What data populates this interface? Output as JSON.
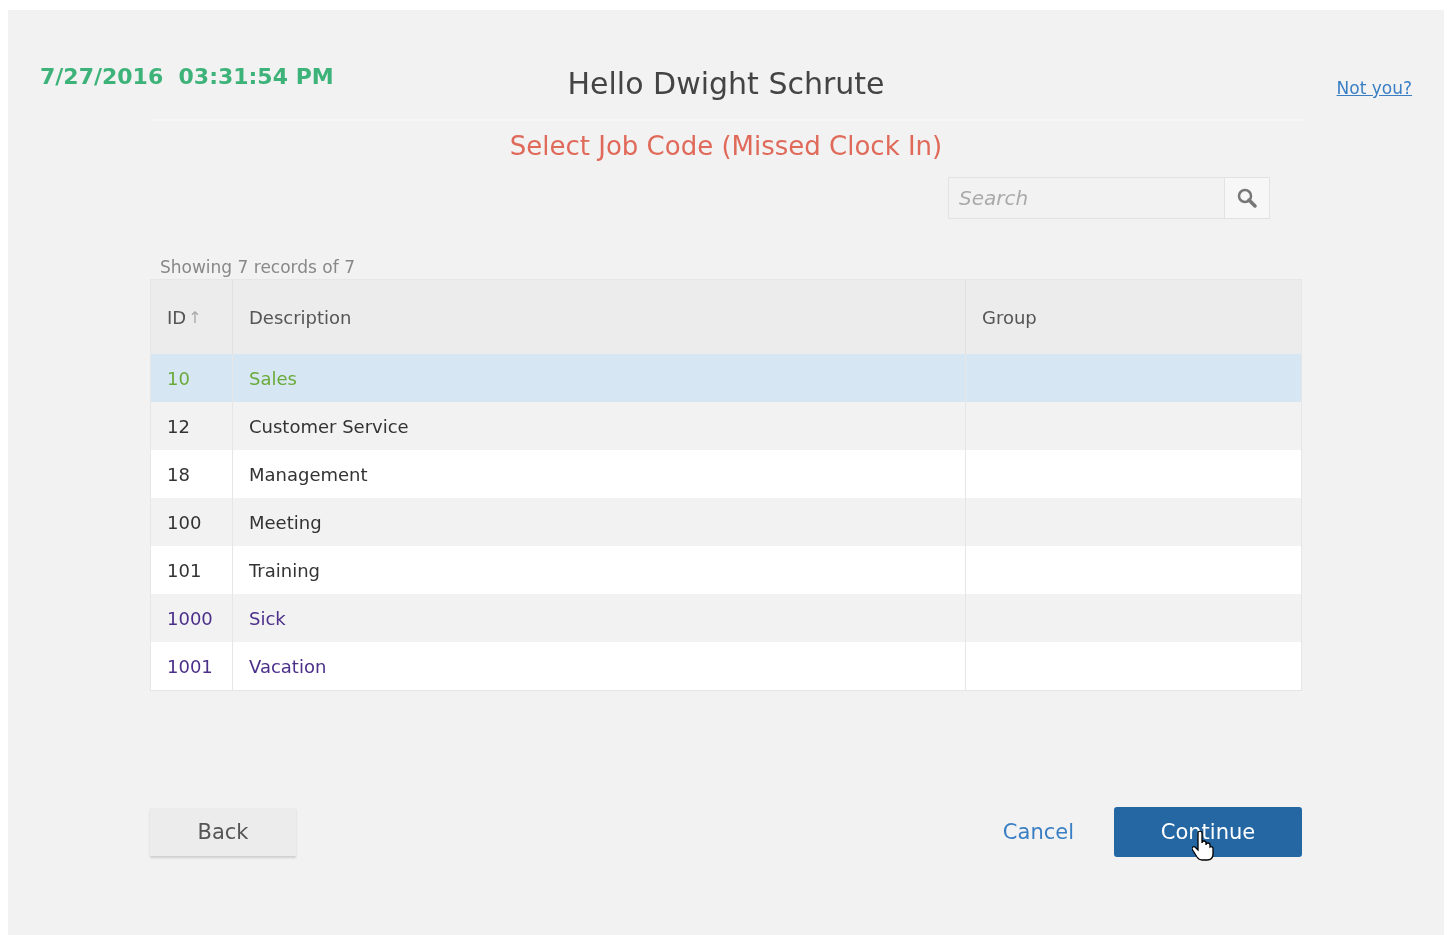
{
  "header": {
    "datetime": "7/27/2016  03:31:54 PM",
    "greeting": "Hello Dwight Schrute",
    "not_you": "Not you?"
  },
  "subtitle": "Select Job Code (Missed Clock In)",
  "search": {
    "placeholder": "Search"
  },
  "table": {
    "summary": "Showing 7 records of 7",
    "columns": [
      {
        "label": "ID",
        "sort": "↑"
      },
      {
        "label": "Description"
      },
      {
        "label": "Group"
      }
    ],
    "rows": [
      {
        "id": "10",
        "description": "Sales",
        "selected": true,
        "color": "#6aaa3a"
      },
      {
        "id": "12",
        "description": "Customer Service",
        "selected": false,
        "color": "#333333"
      },
      {
        "id": "18",
        "description": "Management",
        "selected": false,
        "color": "#333333"
      },
      {
        "id": "100",
        "description": "Meeting",
        "selected": false,
        "color": "#333333"
      },
      {
        "id": "101",
        "description": "Training",
        "selected": false,
        "color": "#333333"
      },
      {
        "id": "1000",
        "description": "Sick",
        "selected": false,
        "color": "#4b2f8a"
      },
      {
        "id": "1001",
        "description": "Vacation",
        "selected": false,
        "color": "#4b2f8a"
      }
    ]
  },
  "buttons": {
    "back": "Back",
    "cancel": "Cancel",
    "continue": "Continue"
  }
}
